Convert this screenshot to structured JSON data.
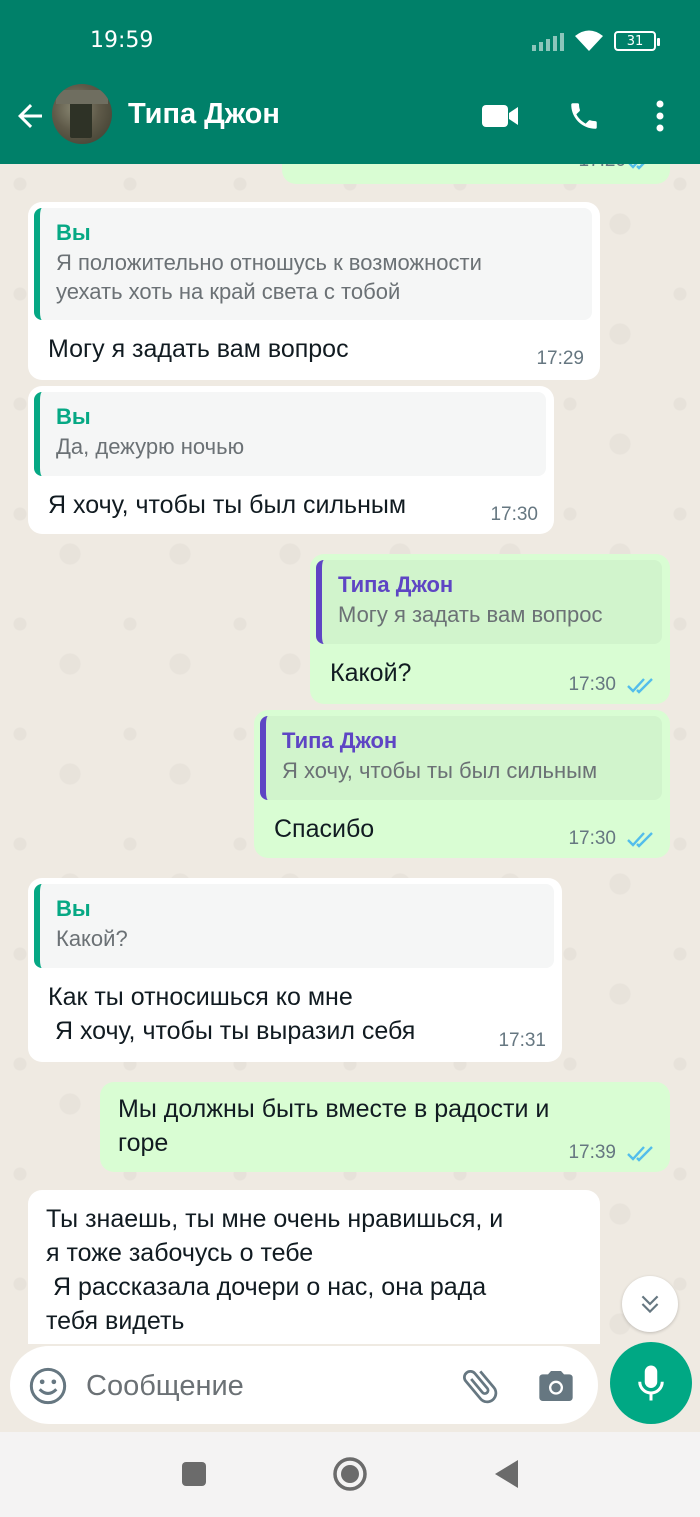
{
  "status_bar": {
    "time": "19:59",
    "battery": "31"
  },
  "header": {
    "contact_name": "Типа Джон"
  },
  "messages": [
    {
      "id": "m0",
      "type": "out",
      "text": "",
      "time": "17:20"
    },
    {
      "id": "m1",
      "type": "in",
      "quote_author": "Вы",
      "quote_text": "Я положительно отношусь к возможности\nуехать хоть на край света с тобой",
      "text": "Могу я задать вам вопрос",
      "time": "17:29"
    },
    {
      "id": "m2",
      "type": "in",
      "quote_author": "Вы",
      "quote_text": "Да, дежурю ночью",
      "text": "Я хочу, чтобы ты был сильным",
      "time": "17:30"
    },
    {
      "id": "m3",
      "type": "out",
      "quote_author": "Типа Джон",
      "quote_text": "Могу я задать вам вопрос",
      "text": "Какой?",
      "time": "17:30"
    },
    {
      "id": "m4",
      "type": "out",
      "quote_author": "Типа Джон",
      "quote_text": "Я хочу, чтобы ты был сильным",
      "text": "Спасибо",
      "time": "17:30"
    },
    {
      "id": "m5",
      "type": "in",
      "quote_author": "Вы",
      "quote_text": "Какой?",
      "text": "Как ты относишься ко мне\n Я хочу, чтобы ты выразил себя",
      "time": "17:31"
    },
    {
      "id": "m6",
      "type": "out",
      "text": "Мы должны быть вместе в радости и\nгоре",
      "time": "17:39"
    },
    {
      "id": "m7",
      "type": "in",
      "text": "Ты знаешь, ты мне очень нравишься, и\nя тоже забочусь о тебе\n Я рассказала дочери о нас, она рада\nтебя видеть"
    }
  ],
  "composer": {
    "placeholder": "Сообщение"
  },
  "colors": {
    "header": "#008069",
    "accent": "#00a884",
    "outgoing_bubble": "#d9fdd3",
    "incoming_bubble": "#ffffff",
    "tick_read": "#53bdeb"
  },
  "icons": [
    "back-arrow-icon",
    "video-call-icon",
    "phone-icon",
    "more-options-icon",
    "double-check-icon",
    "chevron-double-down-icon",
    "emoji-icon",
    "attach-icon",
    "camera-icon",
    "mic-icon",
    "nav-recents-icon",
    "nav-home-icon",
    "nav-back-icon"
  ]
}
